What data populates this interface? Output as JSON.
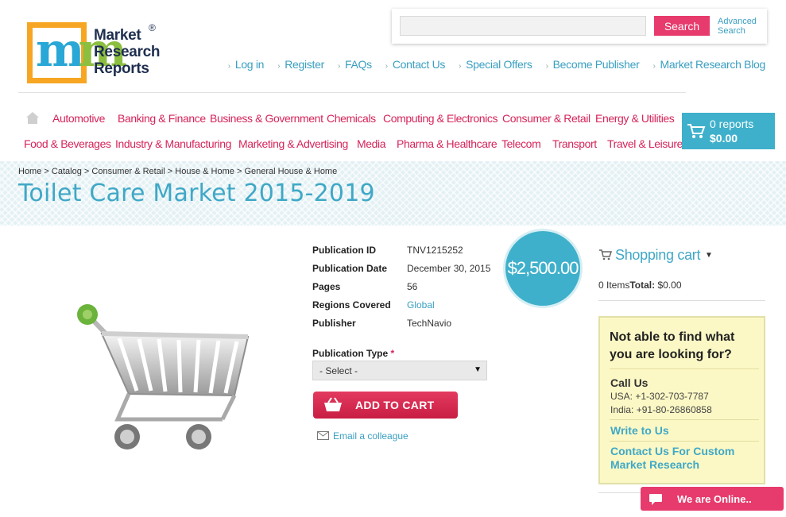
{
  "logo": {
    "line1": "Market",
    "line2": "Research",
    "line3": "Reports",
    "registered": "®",
    "mark_letter": "m",
    "colors": {
      "frame": "#f7a623",
      "m_left": "#29a7d6",
      "m_right": "#8cbf3f",
      "text": "#1e2e4f"
    }
  },
  "search": {
    "placeholder": "",
    "value": "",
    "button_label": "Search",
    "advanced_label": "Advanced Search"
  },
  "top_links": [
    "Log in",
    "Register",
    "FAQs",
    "Contact Us",
    "Special Offers",
    "Become Publisher",
    "Market Research Blog"
  ],
  "categories_row1": [
    "Automotive",
    "Banking & Finance",
    "Business & Government",
    "Chemicals",
    "Computing & Electronics",
    "Consumer & Retail",
    "Energy & Utilities"
  ],
  "categories_row2": [
    "Food & Beverages",
    "Industry & Manufacturing",
    "Marketing & Advertising",
    "Media",
    "Pharma & Healthcare",
    "Telecom",
    "Transport",
    "Travel & Leisure"
  ],
  "cart_summary": {
    "count": "0 reports",
    "total": "$0.00"
  },
  "breadcrumb": [
    "Home",
    "Catalog",
    "Consumer & Retail",
    "House & Home",
    "General House & Home"
  ],
  "breadcrumb_sep": ">",
  "page_title": "Toilet Care Market 2015-2019",
  "details": [
    {
      "label": "Publication ID",
      "value": "TNV1215252",
      "link": false
    },
    {
      "label": "Publication Date",
      "value": "December 30, 2015",
      "link": false
    },
    {
      "label": "Pages",
      "value": "56",
      "link": false
    },
    {
      "label": "Regions Covered",
      "value": "Global",
      "link": true
    },
    {
      "label": "Publisher",
      "value": "TechNavio",
      "link": false
    }
  ],
  "price": "$2,500.00",
  "publication_type": {
    "label": "Publication Type",
    "required_mark": "*",
    "selected": "- Select -"
  },
  "add_to_cart_label": "ADD TO CART",
  "email_colleague_label": "Email a colleague",
  "shopping_cart": {
    "title": "Shopping cart",
    "items_text": "0 Items",
    "total_label": "Total:",
    "total_value": "$0.00"
  },
  "help": {
    "question": "Not able to find what you are looking for?",
    "call_title": "Call Us",
    "usa": "USA: +1-302-703-7787",
    "india": "India: +91-80-26860858",
    "write": "Write to Us",
    "custom": "Contact Us For Custom Market Research"
  },
  "chat_label": "We are Online..",
  "colors": {
    "accent_pink": "#e63b6c",
    "accent_blue": "#3fb0cb",
    "link_blue": "#3a9fc1",
    "category_red": "#d6245a"
  }
}
